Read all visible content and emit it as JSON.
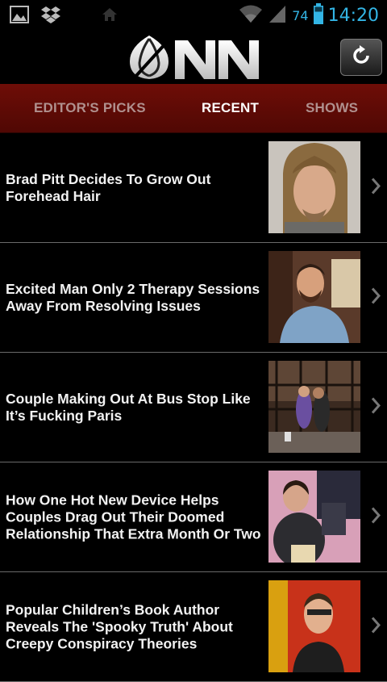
{
  "status_bar": {
    "battery": "74",
    "time": "14:20",
    "icons": [
      "image-icon",
      "dropbox-icon",
      "home-icon",
      "wifi-icon",
      "signal-icon",
      "battery-icon"
    ]
  },
  "header": {
    "logo_text": "ONN",
    "refresh_icon": "refresh-icon"
  },
  "tabs": [
    {
      "label": "EDITOR'S PICKS",
      "active": false
    },
    {
      "label": "RECENT",
      "active": true
    },
    {
      "label": "SHOWS",
      "active": false
    }
  ],
  "articles": [
    {
      "title": "Brad Pitt Decides To Grow Out Forehead Hair"
    },
    {
      "title": "Excited Man Only 2 Therapy Sessions Away From Resolving Issues"
    },
    {
      "title": "Couple Making Out At Bus Stop Like It’s Fucking Paris"
    },
    {
      "title": "How One Hot New Device Helps Couples Drag Out Their Doomed Relationship That Extra Month Or Two"
    },
    {
      "title": "Popular Children’s Book Author Reveals The 'Spooky Truth' About Creepy Conspiracy Theories"
    }
  ],
  "colors": {
    "tab_bar": "#600a05",
    "accent": "#33b5e5",
    "divider": "#6a6a6a"
  }
}
